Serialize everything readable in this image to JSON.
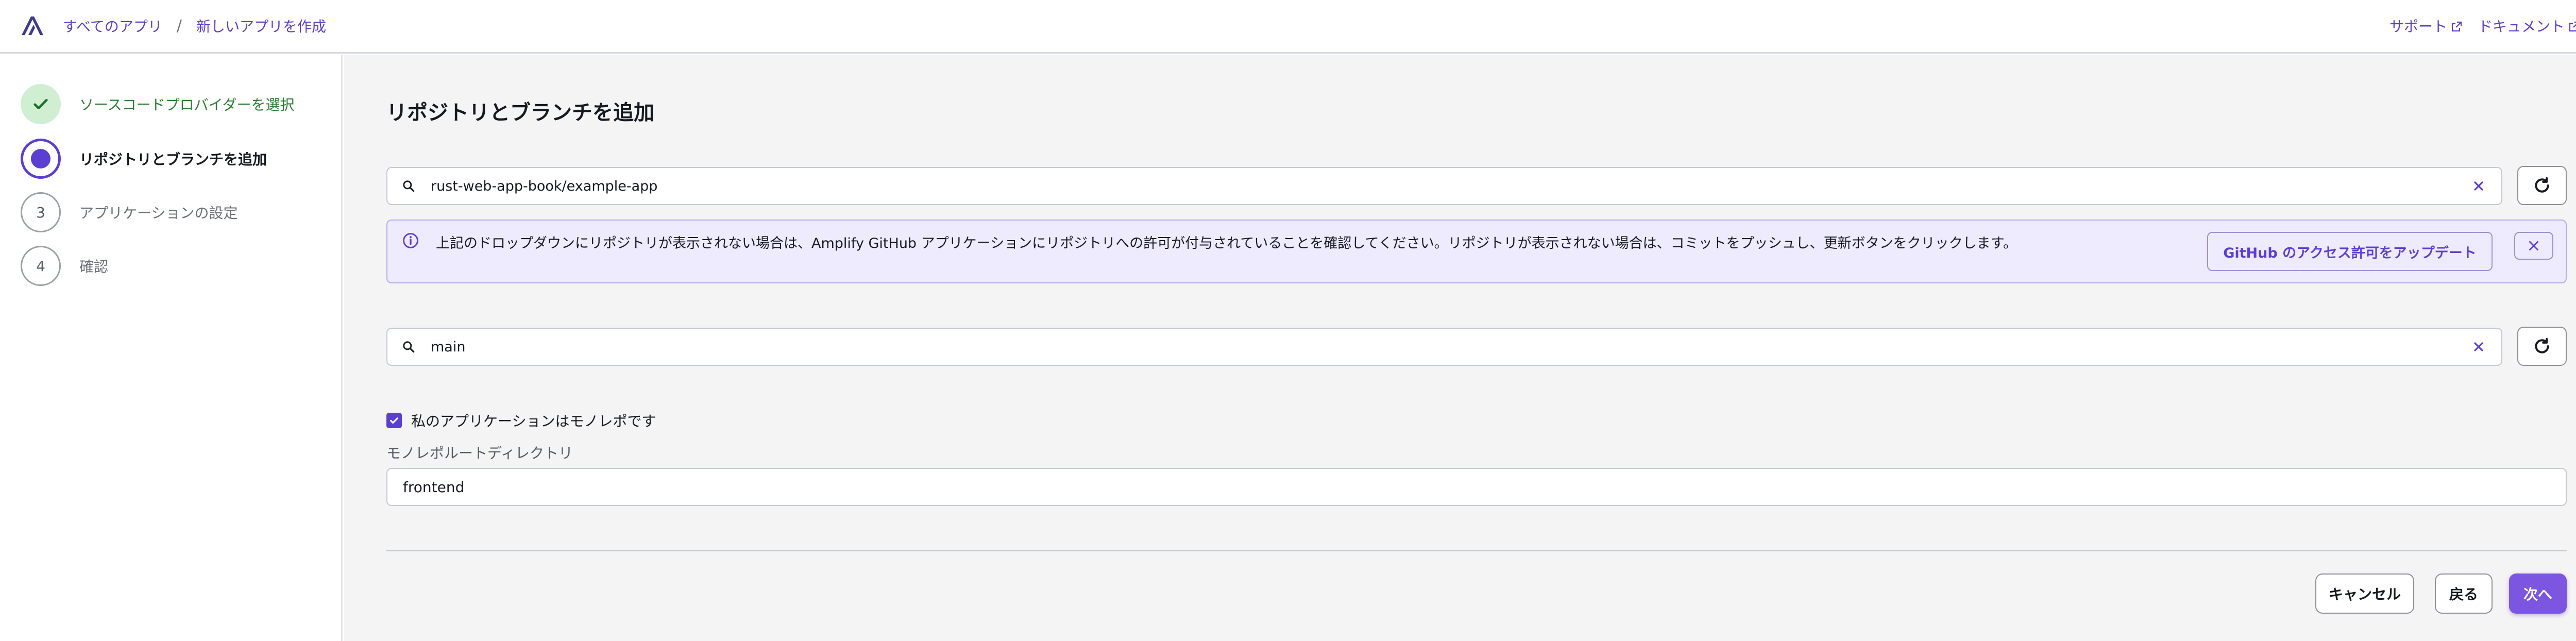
{
  "header": {
    "breadcrumbs": [
      "すべてのアプリ",
      "新しいアプリを作成"
    ],
    "separator": "/",
    "links": [
      "サポート",
      "ドキュメント"
    ]
  },
  "sidebar": {
    "steps": [
      {
        "number": "1",
        "label": "ソースコードプロバイダーを選択",
        "state": "done"
      },
      {
        "number": "2",
        "label": "リポジトリとブランチを追加",
        "state": "active"
      },
      {
        "number": "3",
        "label": "アプリケーションの設定",
        "state": "pending"
      },
      {
        "number": "4",
        "label": "確認",
        "state": "pending"
      }
    ]
  },
  "main": {
    "title": "リポジトリとブランチを追加",
    "repository_value": "rust-web-app-book/example-app",
    "alert": {
      "message": "上記のドロップダウンにリポジトリが表示されない場合は、Amplify GitHub アプリケーションにリポジトリへの許可が付与されていることを確認してください。リポジトリが表示されない場合は、コミットをプッシュし、更新ボタンをクリックします。",
      "button": "GitHub のアクセス許可をアップデート"
    },
    "branch_value": "main",
    "monorepo_checkbox": {
      "label": "私のアプリケーションはモノレポです",
      "checked": true
    },
    "monorepo_root": {
      "label": "モノレポルートディレクトリ",
      "value": "frontend"
    },
    "buttons": {
      "cancel": "キャンセル",
      "back": "戻る",
      "next": "次へ"
    }
  },
  "colors": {
    "accent": "#5b3fd1",
    "primary_button": "#7c56e0",
    "done_step_bg": "#cfeed2",
    "alert_bg": "#efebff"
  },
  "icons": [
    "amplify-logo-icon",
    "external-link-icon",
    "check-icon",
    "search-icon",
    "clear-icon",
    "refresh-icon",
    "info-icon",
    "close-icon",
    "checkbox-check-icon"
  ]
}
